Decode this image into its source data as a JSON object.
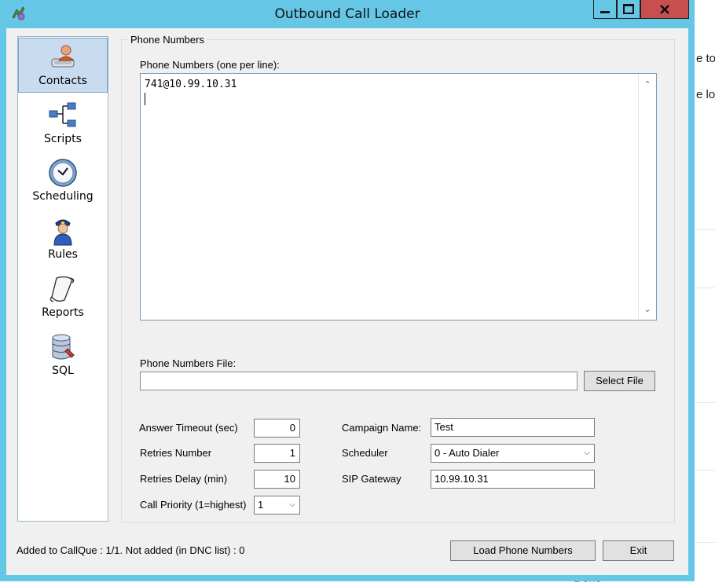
{
  "window": {
    "title": "Outbound Call Loader"
  },
  "sidebar": {
    "items": [
      {
        "label": "Contacts",
        "icon": "contacts-icon"
      },
      {
        "label": "Scripts",
        "icon": "scripts-icon"
      },
      {
        "label": "Scheduling",
        "icon": "clock-icon"
      },
      {
        "label": "Rules",
        "icon": "policeman-icon"
      },
      {
        "label": "Reports",
        "icon": "scroll-icon"
      },
      {
        "label": "SQL",
        "icon": "database-icon"
      }
    ]
  },
  "group": {
    "title": "Phone Numbers",
    "numbers_label": "Phone Numbers (one per line):",
    "numbers_value": "741@10.99.10.31",
    "file_label": "Phone Numbers File:",
    "file_value": "",
    "select_file_button": "Select File"
  },
  "settings": {
    "answer_timeout_label": "Answer Timeout (sec)",
    "answer_timeout_value": "0",
    "retries_number_label": "Retries Number",
    "retries_number_value": "1",
    "retries_delay_label": "Retries Delay (min)",
    "retries_delay_value": "10",
    "call_priority_label": "Call Priority (1=highest)",
    "call_priority_value": "1",
    "campaign_name_label": "Campaign Name:",
    "campaign_name_value": "Test",
    "scheduler_label": "Scheduler",
    "scheduler_value": "0 - Auto Dialer",
    "sip_gateway_label": "SIP Gateway",
    "sip_gateway_value": "10.99.10.31"
  },
  "footer": {
    "status": "Added to CallQue : 1/1. Not added (in DNC list) : 0",
    "load_button": "Load Phone Numbers",
    "exit_button": "Exit"
  },
  "background": {
    "fragment_1": "e to",
    "fragment_2": "e lo",
    "fragment_3": "Done"
  },
  "colors": {
    "titlebar": "#66c6e6",
    "close": "#c7504f",
    "selected": "#c9dcef"
  }
}
